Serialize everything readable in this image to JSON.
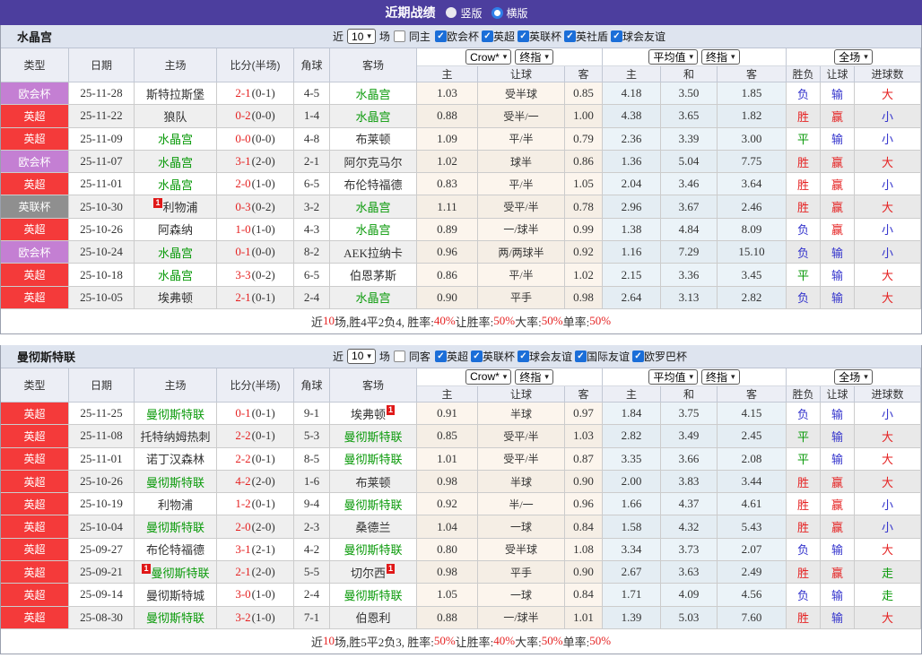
{
  "topbar": {
    "title": "近期战绩",
    "radio_vertical": "竖版",
    "radio_horizontal": "横版",
    "selected": "横版"
  },
  "filters": {
    "near_label": "近",
    "count_value": "10",
    "games_label": "场"
  },
  "table_headers": {
    "left": [
      "类型",
      "日期",
      "主场",
      "比分(半场)",
      "角球",
      "客场"
    ],
    "sub": [
      "主",
      "让球",
      "客",
      "主",
      "和",
      "客",
      "胜负",
      "让球",
      "进球数"
    ],
    "selects": {
      "bookmaker": "Crow*",
      "bookmaker_time": "终指",
      "average": "平均值",
      "average_time": "终指",
      "full_match": "全场"
    }
  },
  "type_colors": {
    "英超": "#f43a3a",
    "欧会杯": "#c47fd3",
    "英联杯": "#8f8f8f"
  },
  "result_colors": {
    "胜": "#e52222",
    "赢": "#e52222",
    "大": "#e52222",
    "负": "#3333cc",
    "输": "#3333cc",
    "小": "#3333cc",
    "平": "#0a9a0a",
    "走": "#0a9a0a"
  },
  "sections": [
    {
      "team": "水晶宫",
      "same_venue_label": "同主",
      "same_venue_checked": false,
      "competitions": [
        "欧会杯",
        "英超",
        "英联杯",
        "英社盾",
        "球会友谊"
      ],
      "rows": [
        {
          "comp": "欧会杯",
          "date": "25-11-28",
          "home": "斯特拉斯堡",
          "home_focus": false,
          "home_mark": "",
          "score": "2-1",
          "half": "(0-1)",
          "corners": "4-5",
          "away": "水晶宫",
          "away_focus": true,
          "away_mark": "",
          "crow_home": "1.03",
          "handicap": "受半球",
          "crow_away": "0.85",
          "avg_home": "4.18",
          "avg_draw": "3.50",
          "avg_away": "1.85",
          "res_wdl": "负",
          "res_handicap": "输",
          "res_goals": "大"
        },
        {
          "comp": "英超",
          "date": "25-11-22",
          "home": "狼队",
          "home_focus": false,
          "home_mark": "",
          "score": "0-2",
          "half": "(0-0)",
          "corners": "1-4",
          "away": "水晶宫",
          "away_focus": true,
          "away_mark": "",
          "crow_home": "0.88",
          "handicap": "受半/一",
          "crow_away": "1.00",
          "avg_home": "4.38",
          "avg_draw": "3.65",
          "avg_away": "1.82",
          "res_wdl": "胜",
          "res_handicap": "赢",
          "res_goals": "小"
        },
        {
          "comp": "英超",
          "date": "25-11-09",
          "home": "水晶宫",
          "home_focus": true,
          "home_mark": "",
          "score": "0-0",
          "half": "(0-0)",
          "corners": "4-8",
          "away": "布莱顿",
          "away_focus": false,
          "away_mark": "",
          "crow_home": "1.09",
          "handicap": "平/半",
          "crow_away": "0.79",
          "avg_home": "2.36",
          "avg_draw": "3.39",
          "avg_away": "3.00",
          "res_wdl": "平",
          "res_handicap": "输",
          "res_goals": "小"
        },
        {
          "comp": "欧会杯",
          "date": "25-11-07",
          "home": "水晶宫",
          "home_focus": true,
          "home_mark": "",
          "score": "3-1",
          "half": "(2-0)",
          "corners": "2-1",
          "away": "阿尔克马尔",
          "away_focus": false,
          "away_mark": "",
          "crow_home": "1.02",
          "handicap": "球半",
          "crow_away": "0.86",
          "avg_home": "1.36",
          "avg_draw": "5.04",
          "avg_away": "7.75",
          "res_wdl": "胜",
          "res_handicap": "赢",
          "res_goals": "大"
        },
        {
          "comp": "英超",
          "date": "25-11-01",
          "home": "水晶宫",
          "home_focus": true,
          "home_mark": "",
          "score": "2-0",
          "half": "(1-0)",
          "corners": "6-5",
          "away": "布伦特福德",
          "away_focus": false,
          "away_mark": "",
          "crow_home": "0.83",
          "handicap": "平/半",
          "crow_away": "1.05",
          "avg_home": "2.04",
          "avg_draw": "3.46",
          "avg_away": "3.64",
          "res_wdl": "胜",
          "res_handicap": "赢",
          "res_goals": "小"
        },
        {
          "comp": "英联杯",
          "date": "25-10-30",
          "home": "利物浦",
          "home_focus": false,
          "home_mark": "1",
          "score": "0-3",
          "half": "(0-2)",
          "corners": "3-2",
          "away": "水晶宫",
          "away_focus": true,
          "away_mark": "",
          "crow_home": "1.11",
          "handicap": "受平/半",
          "crow_away": "0.78",
          "avg_home": "2.96",
          "avg_draw": "3.67",
          "avg_away": "2.46",
          "res_wdl": "胜",
          "res_handicap": "赢",
          "res_goals": "大"
        },
        {
          "comp": "英超",
          "date": "25-10-26",
          "home": "阿森纳",
          "home_focus": false,
          "home_mark": "",
          "score": "1-0",
          "half": "(1-0)",
          "corners": "4-3",
          "away": "水晶宫",
          "away_focus": true,
          "away_mark": "",
          "crow_home": "0.89",
          "handicap": "一/球半",
          "crow_away": "0.99",
          "avg_home": "1.38",
          "avg_draw": "4.84",
          "avg_away": "8.09",
          "res_wdl": "负",
          "res_handicap": "赢",
          "res_goals": "小"
        },
        {
          "comp": "欧会杯",
          "date": "25-10-24",
          "home": "水晶宫",
          "home_focus": true,
          "home_mark": "",
          "score": "0-1",
          "half": "(0-0)",
          "corners": "8-2",
          "away": "AEK拉纳卡",
          "away_focus": false,
          "away_mark": "",
          "crow_home": "0.96",
          "handicap": "两/两球半",
          "crow_away": "0.92",
          "avg_home": "1.16",
          "avg_draw": "7.29",
          "avg_away": "15.10",
          "res_wdl": "负",
          "res_handicap": "输",
          "res_goals": "小"
        },
        {
          "comp": "英超",
          "date": "25-10-18",
          "home": "水晶宫",
          "home_focus": true,
          "home_mark": "",
          "score": "3-3",
          "half": "(0-2)",
          "corners": "6-5",
          "away": "伯恩茅斯",
          "away_focus": false,
          "away_mark": "",
          "crow_home": "0.86",
          "handicap": "平/半",
          "crow_away": "1.02",
          "avg_home": "2.15",
          "avg_draw": "3.36",
          "avg_away": "3.45",
          "res_wdl": "平",
          "res_handicap": "输",
          "res_goals": "大"
        },
        {
          "comp": "英超",
          "date": "25-10-05",
          "home": "埃弗顿",
          "home_focus": false,
          "home_mark": "",
          "score": "2-1",
          "half": "(0-1)",
          "corners": "2-4",
          "away": "水晶宫",
          "away_focus": true,
          "away_mark": "",
          "crow_home": "0.90",
          "handicap": "平手",
          "crow_away": "0.98",
          "avg_home": "2.64",
          "avg_draw": "3.13",
          "avg_away": "2.82",
          "res_wdl": "负",
          "res_handicap": "输",
          "res_goals": "大"
        }
      ],
      "summary": [
        {
          "t": "近"
        },
        {
          "t": "10",
          "red": true
        },
        {
          "t": "场,胜4平2负4, 胜率:"
        },
        {
          "t": "40%",
          "red": true
        },
        {
          "t": " 让胜率:"
        },
        {
          "t": "50%",
          "red": true
        },
        {
          "t": " 大率:"
        },
        {
          "t": "50%",
          "red": true
        },
        {
          "t": " 单率:"
        },
        {
          "t": "50%",
          "red": true
        }
      ]
    },
    {
      "team": "曼彻斯特联",
      "same_venue_label": "同客",
      "same_venue_checked": false,
      "competitions": [
        "英超",
        "英联杯",
        "球会友谊",
        "国际友谊",
        "欧罗巴杯"
      ],
      "rows": [
        {
          "comp": "英超",
          "date": "25-11-25",
          "home": "曼彻斯特联",
          "home_focus": true,
          "home_mark": "",
          "score": "0-1",
          "half": "(0-1)",
          "corners": "9-1",
          "away": "埃弗顿",
          "away_focus": false,
          "away_mark": "1",
          "crow_home": "0.91",
          "handicap": "半球",
          "crow_away": "0.97",
          "avg_home": "1.84",
          "avg_draw": "3.75",
          "avg_away": "4.15",
          "res_wdl": "负",
          "res_handicap": "输",
          "res_goals": "小"
        },
        {
          "comp": "英超",
          "date": "25-11-08",
          "home": "托特纳姆热刺",
          "home_focus": false,
          "home_mark": "",
          "score": "2-2",
          "half": "(0-1)",
          "corners": "5-3",
          "away": "曼彻斯特联",
          "away_focus": true,
          "away_mark": "",
          "crow_home": "0.85",
          "handicap": "受平/半",
          "crow_away": "1.03",
          "avg_home": "2.82",
          "avg_draw": "3.49",
          "avg_away": "2.45",
          "res_wdl": "平",
          "res_handicap": "输",
          "res_goals": "大"
        },
        {
          "comp": "英超",
          "date": "25-11-01",
          "home": "诺丁汉森林",
          "home_focus": false,
          "home_mark": "",
          "score": "2-2",
          "half": "(0-1)",
          "corners": "8-5",
          "away": "曼彻斯特联",
          "away_focus": true,
          "away_mark": "",
          "crow_home": "1.01",
          "handicap": "受平/半",
          "crow_away": "0.87",
          "avg_home": "3.35",
          "avg_draw": "3.66",
          "avg_away": "2.08",
          "res_wdl": "平",
          "res_handicap": "输",
          "res_goals": "大"
        },
        {
          "comp": "英超",
          "date": "25-10-26",
          "home": "曼彻斯特联",
          "home_focus": true,
          "home_mark": "",
          "score": "4-2",
          "half": "(2-0)",
          "corners": "1-6",
          "away": "布莱顿",
          "away_focus": false,
          "away_mark": "",
          "crow_home": "0.98",
          "handicap": "半球",
          "crow_away": "0.90",
          "avg_home": "2.00",
          "avg_draw": "3.83",
          "avg_away": "3.44",
          "res_wdl": "胜",
          "res_handicap": "赢",
          "res_goals": "大"
        },
        {
          "comp": "英超",
          "date": "25-10-19",
          "home": "利物浦",
          "home_focus": false,
          "home_mark": "",
          "score": "1-2",
          "half": "(0-1)",
          "corners": "9-4",
          "away": "曼彻斯特联",
          "away_focus": true,
          "away_mark": "",
          "crow_home": "0.92",
          "handicap": "半/一",
          "crow_away": "0.96",
          "avg_home": "1.66",
          "avg_draw": "4.37",
          "avg_away": "4.61",
          "res_wdl": "胜",
          "res_handicap": "赢",
          "res_goals": "小"
        },
        {
          "comp": "英超",
          "date": "25-10-04",
          "home": "曼彻斯特联",
          "home_focus": true,
          "home_mark": "",
          "score": "2-0",
          "half": "(2-0)",
          "corners": "2-3",
          "away": "桑德兰",
          "away_focus": false,
          "away_mark": "",
          "crow_home": "1.04",
          "handicap": "一球",
          "crow_away": "0.84",
          "avg_home": "1.58",
          "avg_draw": "4.32",
          "avg_away": "5.43",
          "res_wdl": "胜",
          "res_handicap": "赢",
          "res_goals": "小"
        },
        {
          "comp": "英超",
          "date": "25-09-27",
          "home": "布伦特福德",
          "home_focus": false,
          "home_mark": "",
          "score": "3-1",
          "half": "(2-1)",
          "corners": "4-2",
          "away": "曼彻斯特联",
          "away_focus": true,
          "away_mark": "",
          "crow_home": "0.80",
          "handicap": "受半球",
          "crow_away": "1.08",
          "avg_home": "3.34",
          "avg_draw": "3.73",
          "avg_away": "2.07",
          "res_wdl": "负",
          "res_handicap": "输",
          "res_goals": "大"
        },
        {
          "comp": "英超",
          "date": "25-09-21",
          "home": "曼彻斯特联",
          "home_focus": true,
          "home_mark": "1",
          "score": "2-1",
          "half": "(2-0)",
          "corners": "5-5",
          "away": "切尔西",
          "away_focus": false,
          "away_mark": "1",
          "crow_home": "0.98",
          "handicap": "平手",
          "crow_away": "0.90",
          "avg_home": "2.67",
          "avg_draw": "3.63",
          "avg_away": "2.49",
          "res_wdl": "胜",
          "res_handicap": "赢",
          "res_goals": "走"
        },
        {
          "comp": "英超",
          "date": "25-09-14",
          "home": "曼彻斯特城",
          "home_focus": false,
          "home_mark": "",
          "score": "3-0",
          "half": "(1-0)",
          "corners": "2-4",
          "away": "曼彻斯特联",
          "away_focus": true,
          "away_mark": "",
          "crow_home": "1.05",
          "handicap": "一球",
          "crow_away": "0.84",
          "avg_home": "1.71",
          "avg_draw": "4.09",
          "avg_away": "4.56",
          "res_wdl": "负",
          "res_handicap": "输",
          "res_goals": "走"
        },
        {
          "comp": "英超",
          "date": "25-08-30",
          "home": "曼彻斯特联",
          "home_focus": true,
          "home_mark": "",
          "score": "3-2",
          "half": "(1-0)",
          "corners": "7-1",
          "away": "伯恩利",
          "away_focus": false,
          "away_mark": "",
          "crow_home": "0.88",
          "handicap": "一/球半",
          "crow_away": "1.01",
          "avg_home": "1.39",
          "avg_draw": "5.03",
          "avg_away": "7.60",
          "res_wdl": "胜",
          "res_handicap": "输",
          "res_goals": "大"
        }
      ],
      "summary": [
        {
          "t": "近"
        },
        {
          "t": "10",
          "red": true
        },
        {
          "t": "场,胜5平2负3, 胜率:"
        },
        {
          "t": "50%",
          "red": true
        },
        {
          "t": " 让胜率:"
        },
        {
          "t": "40%",
          "red": true
        },
        {
          "t": " 大率:"
        },
        {
          "t": "50%",
          "red": true
        },
        {
          "t": " 单率:"
        },
        {
          "t": "50%",
          "red": true
        }
      ]
    }
  ]
}
